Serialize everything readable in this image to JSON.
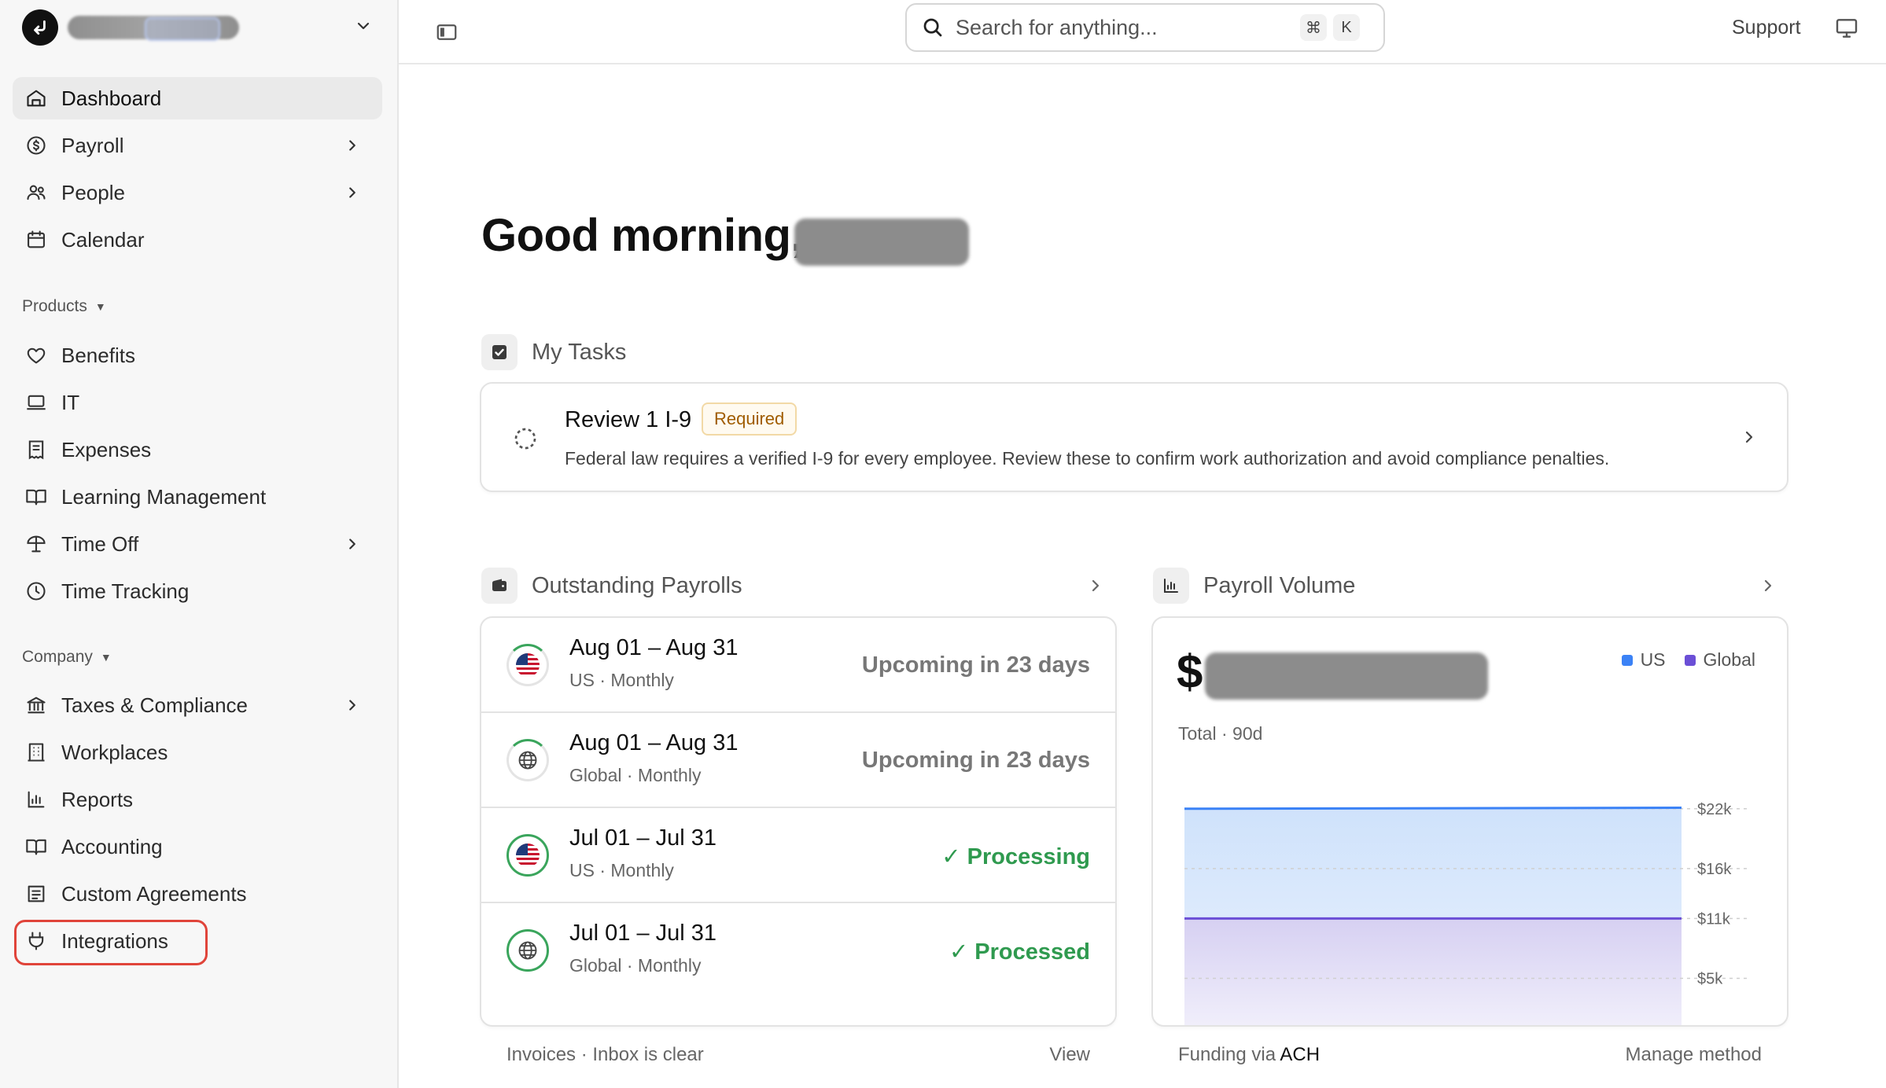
{
  "sidebar": {
    "org_name": "",
    "nav": [
      {
        "label": "Dashboard",
        "icon": "dashboard-icon"
      },
      {
        "label": "Payroll",
        "icon": "dollar-circle-icon"
      },
      {
        "label": "People",
        "icon": "people-icon"
      },
      {
        "label": "Calendar",
        "icon": "calendar-icon"
      }
    ],
    "products_label": "Products",
    "products": [
      {
        "label": "Benefits",
        "icon": "heart-icon"
      },
      {
        "label": "IT",
        "icon": "laptop-icon"
      },
      {
        "label": "Expenses",
        "icon": "receipt-icon"
      },
      {
        "label": "Learning Management",
        "icon": "book-open-icon"
      },
      {
        "label": "Time Off",
        "icon": "umbrella-icon"
      },
      {
        "label": "Time Tracking",
        "icon": "clock-icon"
      }
    ],
    "company_label": "Company",
    "company": [
      {
        "label": "Taxes & Compliance",
        "icon": "bank-icon"
      },
      {
        "label": "Workplaces",
        "icon": "building-icon"
      },
      {
        "label": "Reports",
        "icon": "bar-chart-icon"
      },
      {
        "label": "Accounting",
        "icon": "book-icon"
      },
      {
        "label": "Custom Agreements",
        "icon": "document-list-icon"
      },
      {
        "label": "Integrations",
        "icon": "plug-icon"
      }
    ]
  },
  "topbar": {
    "search_placeholder": "Search for anything...",
    "shortcut_mod": "⌘",
    "shortcut_key": "K",
    "support_label": "Support"
  },
  "main": {
    "greeting": "Good morning,",
    "tasks": {
      "title": "My Tasks",
      "item_title": "Review 1 I-9",
      "item_badge": "Required",
      "item_desc": "Federal law requires a verified I-9 for every employee. Review these to confirm work authorization and avoid compliance penalties."
    },
    "payrolls": {
      "title": "Outstanding Payrolls",
      "rows": [
        {
          "period": "Aug 01 – Aug 31",
          "sub": "US · Monthly",
          "status": "Upcoming in 23 days"
        },
        {
          "period": "Aug 01 – Aug 31",
          "sub": "Global · Monthly",
          "status": "Upcoming in 23 days"
        },
        {
          "period": "Jul 01 – Jul 31",
          "sub": "US · Monthly",
          "status": "✓ Processing"
        },
        {
          "period": "Jul 01 – Jul 31",
          "sub": "Global · Monthly",
          "status": "✓ Processed"
        }
      ],
      "footer_left": "Invoices · Inbox is clear",
      "footer_right": "View"
    },
    "volume": {
      "title": "Payroll Volume",
      "currency": "$",
      "sub": "Total · 90d",
      "legend_us": "US",
      "legend_global": "Global",
      "footer_left_prefix": "Funding via ",
      "footer_left_method": "ACH",
      "footer_right": "Manage method"
    }
  },
  "colors": {
    "us_series": "#3b82f6",
    "global_series": "#6b4fd6",
    "status_green": "#2f9a4f",
    "highlight": "#e0443a"
  },
  "chart_data": {
    "type": "area",
    "ylabels": [
      "$22k",
      "$16k",
      "$11k",
      "$5k"
    ],
    "series": [
      {
        "name": "US",
        "values": [
          22000,
          22100
        ]
      },
      {
        "name": "Global",
        "values": [
          11000,
          11000
        ]
      }
    ]
  }
}
